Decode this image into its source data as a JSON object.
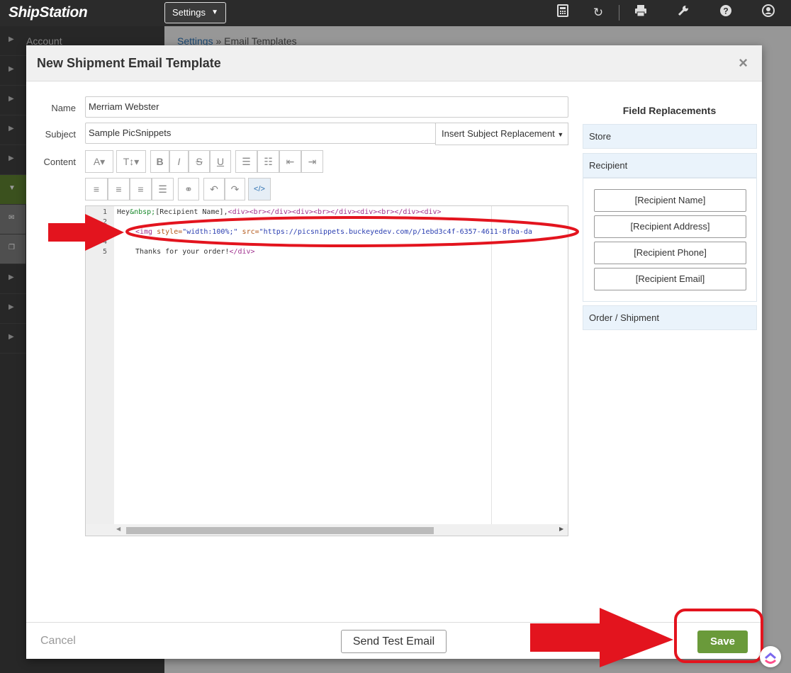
{
  "app": {
    "logo": "ShipStation"
  },
  "topbar": {
    "settings_label": "Settings",
    "icons": [
      "calculator-icon",
      "refresh-icon",
      "printer-icon",
      "wrench-icon",
      "help-icon",
      "user-icon"
    ]
  },
  "sidebar": {
    "first_item": "Account"
  },
  "page": {
    "breadcrumb_link": "Settings",
    "breadcrumb_sep": " » ",
    "breadcrumb_current": "Email Templates"
  },
  "modal": {
    "title": "New Shipment Email Template",
    "close_label": "×",
    "name_label": "Name",
    "name_value": "Merriam Webster",
    "subject_label": "Subject",
    "subject_value": "Sample PicSnippets",
    "insert_subject_label": "Insert Subject Replacement",
    "content_label": "Content"
  },
  "editor": {
    "line_numbers": [
      "1",
      "2",
      "3",
      "4",
      "5"
    ],
    "line1": {
      "p1": "Hey",
      "p2": "&nbsp;",
      "p3": "[Recipient Name],",
      "p4": "<div><br></div><div><br></div><div><br></div><div>"
    },
    "line3": {
      "p1": "<img",
      "p2": " style=",
      "p3": "\"width:100%;\"",
      "p4": " src=",
      "p5": "\"https://picsnippets.buckeyedev.com/p/1ebd3c4f-6357-4611-8fba-da"
    },
    "line5": {
      "p1": "Thanks for your order!",
      "p2": "</div>"
    }
  },
  "field_replacements": {
    "title": "Field Replacements",
    "sections": [
      "Store",
      "Recipient",
      "Order / Shipment"
    ],
    "recipient_buttons": [
      "[Recipient Name]",
      "[Recipient Address]",
      "[Recipient Phone]",
      "[Recipient Email]"
    ]
  },
  "footer": {
    "cancel": "Cancel",
    "send_test": "Send Test Email",
    "save": "Save"
  },
  "colors": {
    "save_green": "#6a9a3a",
    "annotation_red": "#e3141e",
    "topbar": "#2b2b2b"
  }
}
